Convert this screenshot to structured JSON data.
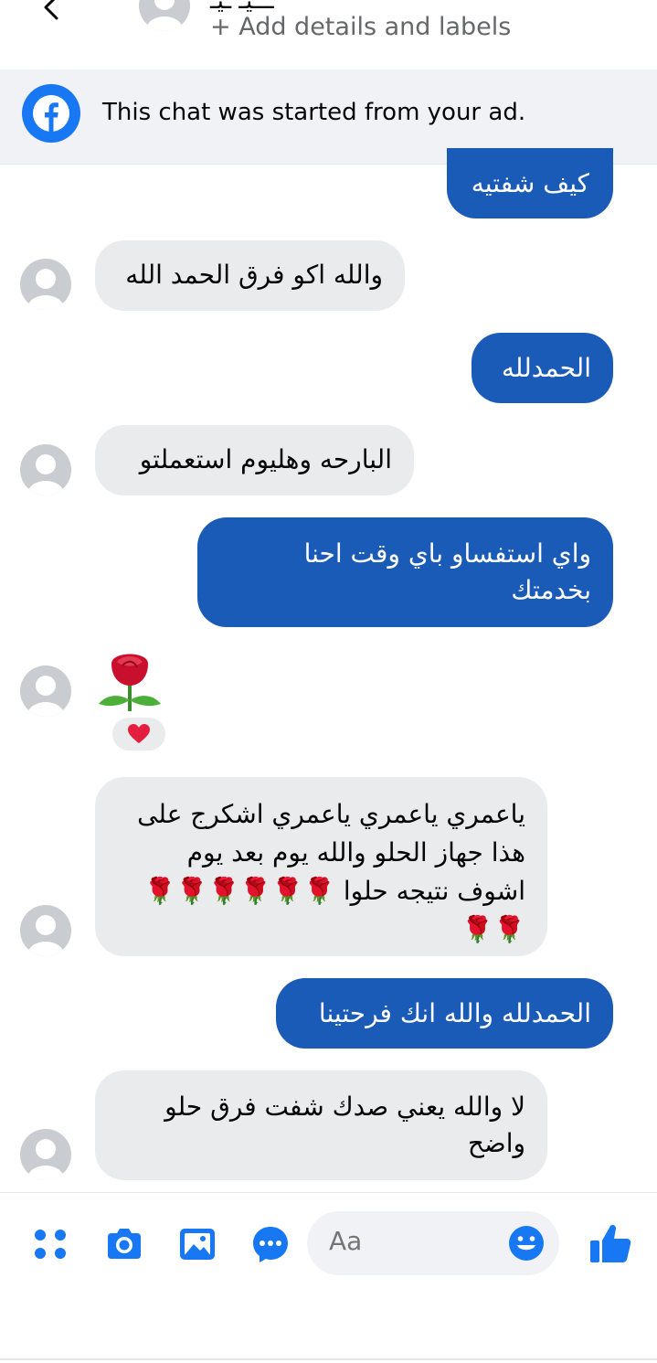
{
  "header": {
    "back_icon": "chevron-left-icon",
    "name_fragment": "ـــيـ ـيـ",
    "add_details": "+ Add details and labels"
  },
  "ad_banner": {
    "icon": "facebook-icon",
    "text": "This chat was started from your ad."
  },
  "messages": [
    {
      "side": "sent",
      "text": "كيف شفتيه"
    },
    {
      "side": "received",
      "text": "والله اكو فرق الحمد الله"
    },
    {
      "side": "sent",
      "text": "الحمدلله"
    },
    {
      "side": "received",
      "text": "البارحه وهليوم استعملتو"
    },
    {
      "side": "sent",
      "line1": "واي استفساو باي وقت احنا",
      "line2": "بخدمتك"
    },
    {
      "side": "received",
      "emoji": "rose",
      "reaction": "heart"
    },
    {
      "side": "received",
      "line1": "ياعمري ياعمري ياعمري اشكرج على",
      "line2": "هذا جهاز الحلو والله يوم بعد يوم",
      "line3": "اشوف نتيجه حلوا 🌹🌹🌹🌹🌹🌹",
      "line4": "🌹🌹"
    },
    {
      "side": "sent",
      "text": "الحمدلله والله انك فرحتينا"
    },
    {
      "side": "received",
      "line1": "لا والله يعني صدك شفت فرق حلو",
      "line2": "واضح"
    }
  ],
  "composer": {
    "placeholder": "Aa",
    "tools": [
      "apps-icon",
      "camera-icon",
      "gallery-icon",
      "chat-bubble-icon"
    ],
    "emoji_icon": "smiley-icon",
    "like_icon": "thumbs-up-icon"
  },
  "colors": {
    "sent_bubble": "#1b5bb8",
    "received_bubble": "#eaebed",
    "accent": "#1877f2"
  }
}
